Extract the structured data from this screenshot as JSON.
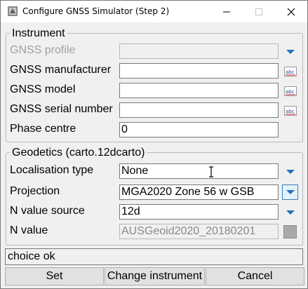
{
  "window": {
    "title": "Configure GNSS Simulator (Step 2)"
  },
  "instrument": {
    "group_title": "Instrument",
    "rows": [
      {
        "label": "GNSS profile",
        "value": "",
        "button_icon": "chevron-down-icon",
        "disabled": true
      },
      {
        "label": "GNSS manufacturer",
        "value": "",
        "button_icon": "abc-text-icon"
      },
      {
        "label": "GNSS model",
        "value": "",
        "button_icon": "abc-text-icon"
      },
      {
        "label": "GNSS serial number",
        "value": "",
        "button_icon": "abc-text-icon"
      },
      {
        "label": "Phase centre",
        "value": "0"
      }
    ]
  },
  "geodetics": {
    "group_title": "Geodetics (carto.12dcarto)",
    "rows": [
      {
        "label": "Localisation type",
        "value": "None",
        "button_icon": "chevron-down-icon"
      },
      {
        "label": "Projection",
        "value": "MGA2020 Zone 56 w GSB",
        "button_icon": "chevron-down-icon"
      },
      {
        "label": "N value source",
        "value": "12d",
        "button_icon": "chevron-down-icon"
      },
      {
        "label": "N value",
        "value": "AUSGeoid2020_20180201",
        "button_icon": "grey-square-icon",
        "disabled": true
      }
    ]
  },
  "status_text": "choice ok",
  "buttons": {
    "set": "Set",
    "change_instrument": "Change instrument",
    "cancel": "Cancel"
  },
  "colors": {
    "chevron_blue": "#2a6ebb",
    "abc_red": "#c8102e",
    "window_bg": "#f0f0f0"
  }
}
